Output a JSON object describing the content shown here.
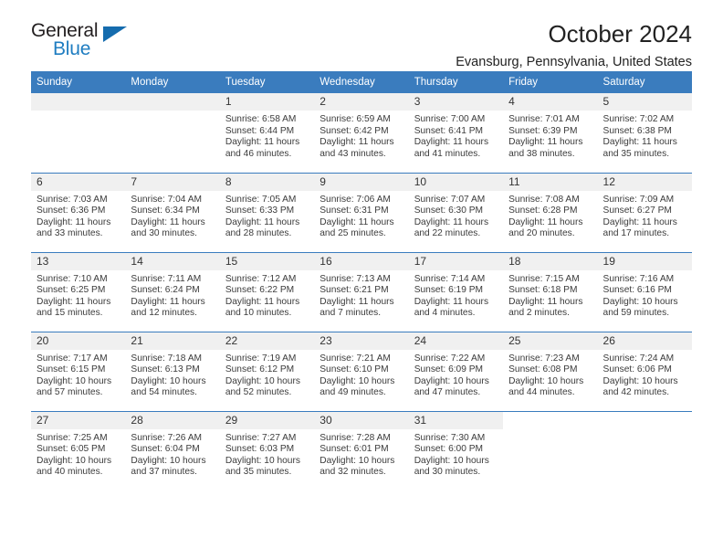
{
  "logo": {
    "word_top": "General",
    "word_bottom": "Blue",
    "triangle_color": "#156cae",
    "blue": "#1f7dc1"
  },
  "header": {
    "title": "October 2024",
    "subtitle": "Evansburg, Pennsylvania, United States"
  },
  "theme": {
    "header_blue": "#3a7cbe",
    "daynum_bg": "#f0f0f0",
    "text": "#3b3b3b"
  },
  "labels": {
    "sunrise_prefix": "Sunrise:",
    "sunset_prefix": "Sunset:",
    "daylight_prefix": "Daylight:"
  },
  "weekdays": [
    "Sunday",
    "Monday",
    "Tuesday",
    "Wednesday",
    "Thursday",
    "Friday",
    "Saturday"
  ],
  "weeks": [
    [
      {
        "day": "",
        "sunrise": "",
        "sunset": "",
        "daylight1": "",
        "daylight2": ""
      },
      {
        "day": "",
        "sunrise": "",
        "sunset": "",
        "daylight1": "",
        "daylight2": ""
      },
      {
        "day": "1",
        "sunrise": "Sunrise: 6:58 AM",
        "sunset": "Sunset: 6:44 PM",
        "daylight1": "Daylight: 11 hours",
        "daylight2": "and 46 minutes."
      },
      {
        "day": "2",
        "sunrise": "Sunrise: 6:59 AM",
        "sunset": "Sunset: 6:42 PM",
        "daylight1": "Daylight: 11 hours",
        "daylight2": "and 43 minutes."
      },
      {
        "day": "3",
        "sunrise": "Sunrise: 7:00 AM",
        "sunset": "Sunset: 6:41 PM",
        "daylight1": "Daylight: 11 hours",
        "daylight2": "and 41 minutes."
      },
      {
        "day": "4",
        "sunrise": "Sunrise: 7:01 AM",
        "sunset": "Sunset: 6:39 PM",
        "daylight1": "Daylight: 11 hours",
        "daylight2": "and 38 minutes."
      },
      {
        "day": "5",
        "sunrise": "Sunrise: 7:02 AM",
        "sunset": "Sunset: 6:38 PM",
        "daylight1": "Daylight: 11 hours",
        "daylight2": "and 35 minutes."
      }
    ],
    [
      {
        "day": "6",
        "sunrise": "Sunrise: 7:03 AM",
        "sunset": "Sunset: 6:36 PM",
        "daylight1": "Daylight: 11 hours",
        "daylight2": "and 33 minutes."
      },
      {
        "day": "7",
        "sunrise": "Sunrise: 7:04 AM",
        "sunset": "Sunset: 6:34 PM",
        "daylight1": "Daylight: 11 hours",
        "daylight2": "and 30 minutes."
      },
      {
        "day": "8",
        "sunrise": "Sunrise: 7:05 AM",
        "sunset": "Sunset: 6:33 PM",
        "daylight1": "Daylight: 11 hours",
        "daylight2": "and 28 minutes."
      },
      {
        "day": "9",
        "sunrise": "Sunrise: 7:06 AM",
        "sunset": "Sunset: 6:31 PM",
        "daylight1": "Daylight: 11 hours",
        "daylight2": "and 25 minutes."
      },
      {
        "day": "10",
        "sunrise": "Sunrise: 7:07 AM",
        "sunset": "Sunset: 6:30 PM",
        "daylight1": "Daylight: 11 hours",
        "daylight2": "and 22 minutes."
      },
      {
        "day": "11",
        "sunrise": "Sunrise: 7:08 AM",
        "sunset": "Sunset: 6:28 PM",
        "daylight1": "Daylight: 11 hours",
        "daylight2": "and 20 minutes."
      },
      {
        "day": "12",
        "sunrise": "Sunrise: 7:09 AM",
        "sunset": "Sunset: 6:27 PM",
        "daylight1": "Daylight: 11 hours",
        "daylight2": "and 17 minutes."
      }
    ],
    [
      {
        "day": "13",
        "sunrise": "Sunrise: 7:10 AM",
        "sunset": "Sunset: 6:25 PM",
        "daylight1": "Daylight: 11 hours",
        "daylight2": "and 15 minutes."
      },
      {
        "day": "14",
        "sunrise": "Sunrise: 7:11 AM",
        "sunset": "Sunset: 6:24 PM",
        "daylight1": "Daylight: 11 hours",
        "daylight2": "and 12 minutes."
      },
      {
        "day": "15",
        "sunrise": "Sunrise: 7:12 AM",
        "sunset": "Sunset: 6:22 PM",
        "daylight1": "Daylight: 11 hours",
        "daylight2": "and 10 minutes."
      },
      {
        "day": "16",
        "sunrise": "Sunrise: 7:13 AM",
        "sunset": "Sunset: 6:21 PM",
        "daylight1": "Daylight: 11 hours",
        "daylight2": "and 7 minutes."
      },
      {
        "day": "17",
        "sunrise": "Sunrise: 7:14 AM",
        "sunset": "Sunset: 6:19 PM",
        "daylight1": "Daylight: 11 hours",
        "daylight2": "and 4 minutes."
      },
      {
        "day": "18",
        "sunrise": "Sunrise: 7:15 AM",
        "sunset": "Sunset: 6:18 PM",
        "daylight1": "Daylight: 11 hours",
        "daylight2": "and 2 minutes."
      },
      {
        "day": "19",
        "sunrise": "Sunrise: 7:16 AM",
        "sunset": "Sunset: 6:16 PM",
        "daylight1": "Daylight: 10 hours",
        "daylight2": "and 59 minutes."
      }
    ],
    [
      {
        "day": "20",
        "sunrise": "Sunrise: 7:17 AM",
        "sunset": "Sunset: 6:15 PM",
        "daylight1": "Daylight: 10 hours",
        "daylight2": "and 57 minutes."
      },
      {
        "day": "21",
        "sunrise": "Sunrise: 7:18 AM",
        "sunset": "Sunset: 6:13 PM",
        "daylight1": "Daylight: 10 hours",
        "daylight2": "and 54 minutes."
      },
      {
        "day": "22",
        "sunrise": "Sunrise: 7:19 AM",
        "sunset": "Sunset: 6:12 PM",
        "daylight1": "Daylight: 10 hours",
        "daylight2": "and 52 minutes."
      },
      {
        "day": "23",
        "sunrise": "Sunrise: 7:21 AM",
        "sunset": "Sunset: 6:10 PM",
        "daylight1": "Daylight: 10 hours",
        "daylight2": "and 49 minutes."
      },
      {
        "day": "24",
        "sunrise": "Sunrise: 7:22 AM",
        "sunset": "Sunset: 6:09 PM",
        "daylight1": "Daylight: 10 hours",
        "daylight2": "and 47 minutes."
      },
      {
        "day": "25",
        "sunrise": "Sunrise: 7:23 AM",
        "sunset": "Sunset: 6:08 PM",
        "daylight1": "Daylight: 10 hours",
        "daylight2": "and 44 minutes."
      },
      {
        "day": "26",
        "sunrise": "Sunrise: 7:24 AM",
        "sunset": "Sunset: 6:06 PM",
        "daylight1": "Daylight: 10 hours",
        "daylight2": "and 42 minutes."
      }
    ],
    [
      {
        "day": "27",
        "sunrise": "Sunrise: 7:25 AM",
        "sunset": "Sunset: 6:05 PM",
        "daylight1": "Daylight: 10 hours",
        "daylight2": "and 40 minutes."
      },
      {
        "day": "28",
        "sunrise": "Sunrise: 7:26 AM",
        "sunset": "Sunset: 6:04 PM",
        "daylight1": "Daylight: 10 hours",
        "daylight2": "and 37 minutes."
      },
      {
        "day": "29",
        "sunrise": "Sunrise: 7:27 AM",
        "sunset": "Sunset: 6:03 PM",
        "daylight1": "Daylight: 10 hours",
        "daylight2": "and 35 minutes."
      },
      {
        "day": "30",
        "sunrise": "Sunrise: 7:28 AM",
        "sunset": "Sunset: 6:01 PM",
        "daylight1": "Daylight: 10 hours",
        "daylight2": "and 32 minutes."
      },
      {
        "day": "31",
        "sunrise": "Sunrise: 7:30 AM",
        "sunset": "Sunset: 6:00 PM",
        "daylight1": "Daylight: 10 hours",
        "daylight2": "and 30 minutes."
      },
      {
        "day": "",
        "sunrise": "",
        "sunset": "",
        "daylight1": "",
        "daylight2": ""
      },
      {
        "day": "",
        "sunrise": "",
        "sunset": "",
        "daylight1": "",
        "daylight2": ""
      }
    ]
  ]
}
